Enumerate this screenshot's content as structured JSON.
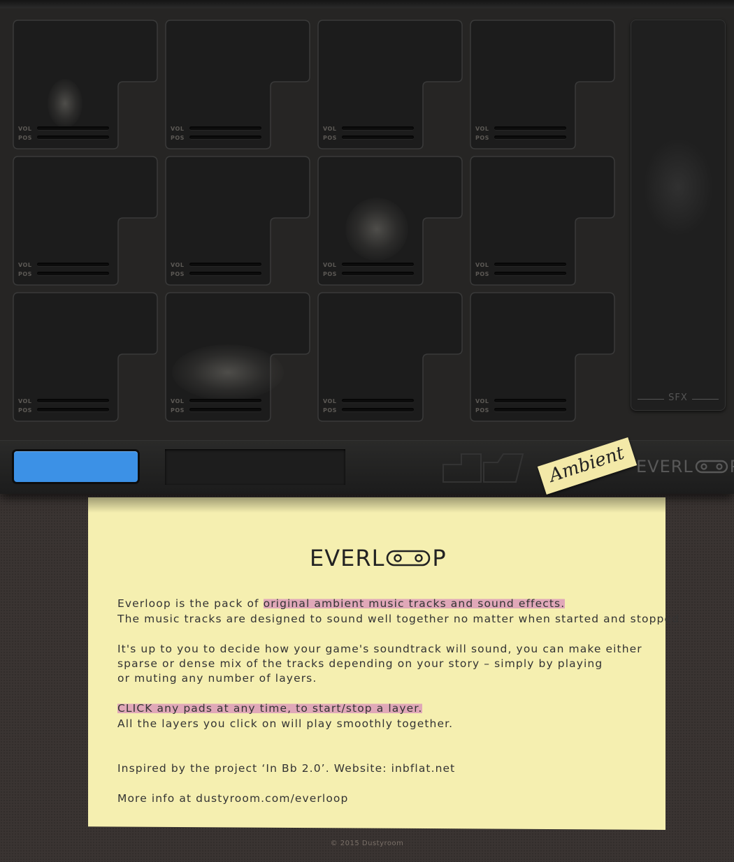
{
  "device": {
    "pad_labels": {
      "vol": "VOL",
      "pos": "POS"
    },
    "sfx_label": "SFX",
    "tag_label": "Ambient",
    "brand": {
      "prefix": "EVERL",
      "suffix": "P"
    }
  },
  "colors": {
    "play_button": "#3c91e6",
    "paper": "#f5efb0",
    "highlight": "#d582bc"
  },
  "note": {
    "logo": {
      "prefix": "EVERL",
      "suffix": "P"
    },
    "p1": {
      "line1_pre": "Everloop is the pack of ",
      "line1_hl": "original ambient music tracks and sound effects.",
      "line2": "The music tracks are designed to sound well together no matter when started and stopped."
    },
    "p2": {
      "line1": "It's up to you to decide how your game's soundtrack will sound, you can make either",
      "line2": "sparse or dense mix of the tracks depending on your story – simply by playing",
      "line3": "or muting any number of layers."
    },
    "p3": {
      "line1": "CLICK any pads at any time, to start/stop a layer.",
      "line2": "All the layers you click on will play smoothly together."
    },
    "p4": "Inspired by the project ‘In Bb 2.0’. Website: inbflat.net",
    "p5": "More info at dustyroom.com/everloop"
  },
  "footer": "© 2015 Dustyroom"
}
